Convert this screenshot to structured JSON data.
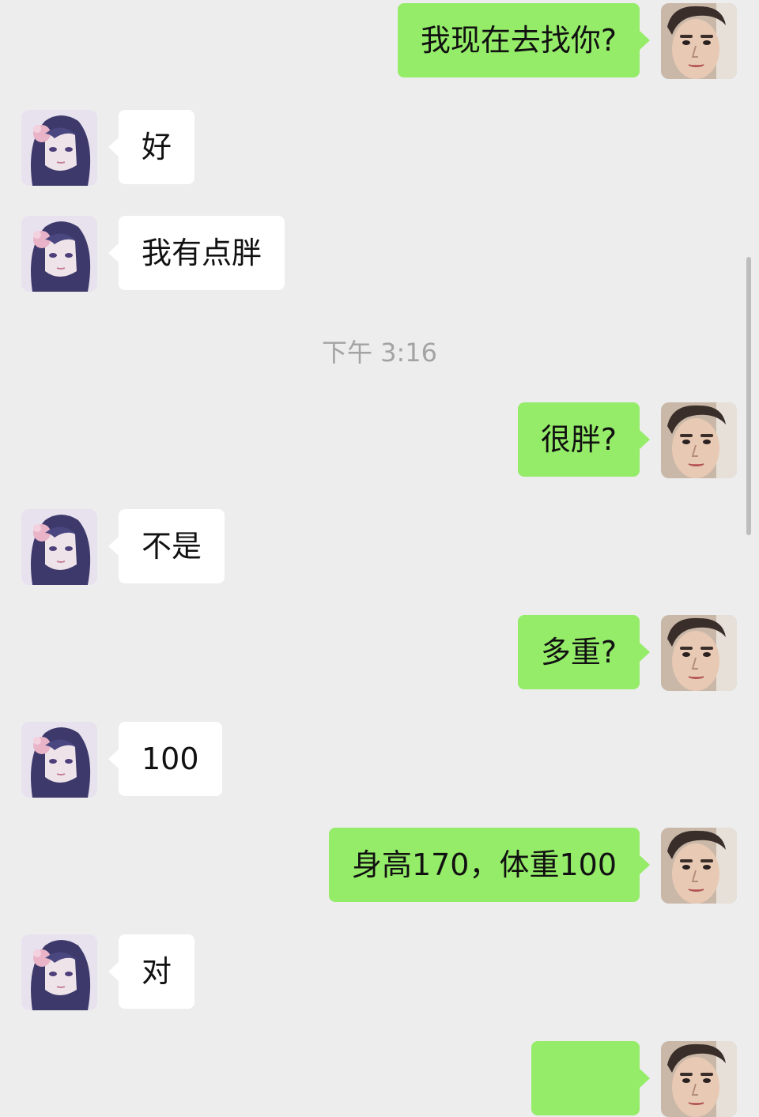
{
  "messages": [
    {
      "side": "right",
      "text": "我现在去找你?"
    },
    {
      "side": "left",
      "text": "好"
    },
    {
      "side": "left",
      "text": "我有点胖"
    },
    {
      "side": "right",
      "text": "很胖?"
    },
    {
      "side": "left",
      "text": "不是"
    },
    {
      "side": "right",
      "text": "多重?"
    },
    {
      "side": "left",
      "text": "100"
    },
    {
      "side": "right",
      "text": "身高170，体重100"
    },
    {
      "side": "left",
      "text": "对"
    },
    {
      "side": "right",
      "text": ""
    }
  ],
  "timestamp": "下午 3:16",
  "colors": {
    "background": "#ededed",
    "sent_bubble": "#95ec69",
    "received_bubble": "#ffffff",
    "timestamp_text": "#a3a3a3"
  },
  "avatars": {
    "self": "male-portrait-avatar",
    "contact": "anime-girl-avatar"
  }
}
